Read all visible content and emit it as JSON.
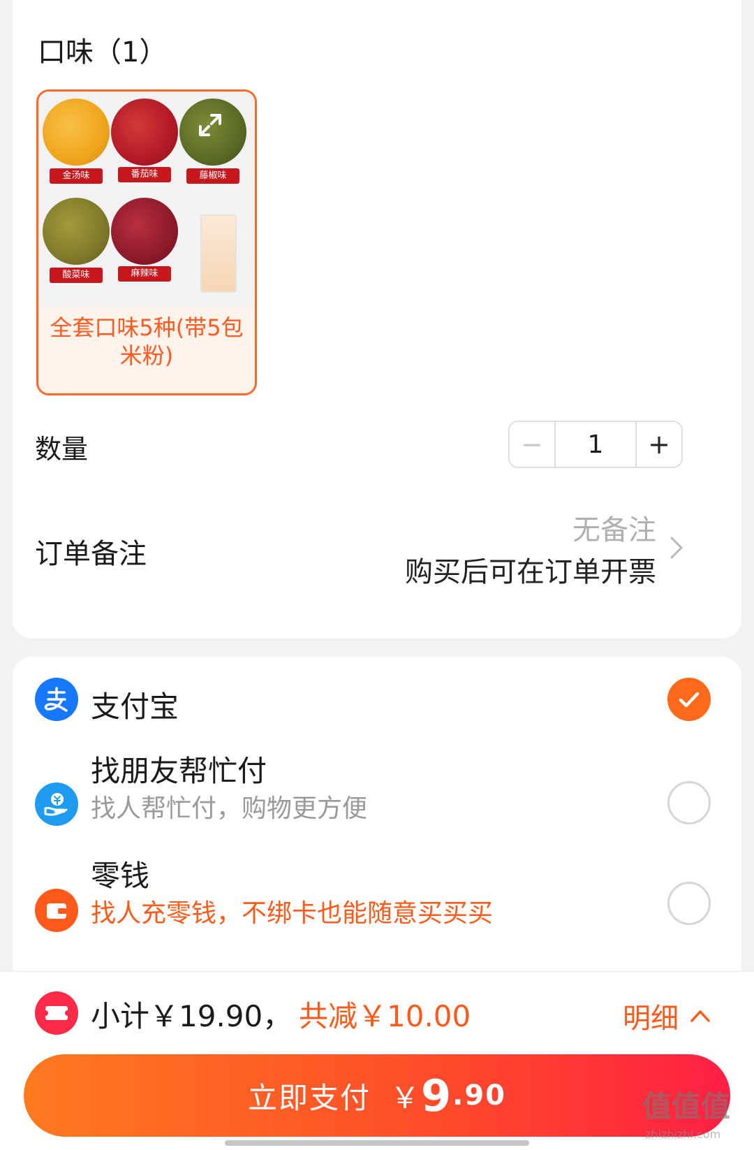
{
  "flavor": {
    "title": "口味（1）",
    "option_label": "全套口味5种(带5包米粉)",
    "bowls": [
      {
        "tag": "金汤味",
        "color": "#f0a51c"
      },
      {
        "tag": "番茄味",
        "color": "#b21a26"
      },
      {
        "tag": "藤椒味",
        "color": "#5a6b24"
      },
      {
        "tag": "酸菜味",
        "color": "#7f7a2a"
      },
      {
        "tag": "麻辣味",
        "color": "#8e1a2a"
      }
    ]
  },
  "quantity": {
    "label": "数量",
    "minus": "−",
    "value": "1",
    "plus": "+"
  },
  "note": {
    "label": "订单备注",
    "value": "无备注",
    "sub": "购买后可在订单开票"
  },
  "payment": {
    "methods": [
      {
        "title": "支付宝",
        "subtitle": "",
        "icon": "alipay-icon",
        "selected": true
      },
      {
        "title": "找朋友帮忙付",
        "subtitle": "找人帮忙付，购物更方便",
        "icon": "friend-pay-icon",
        "selected": false
      },
      {
        "title": "零钱",
        "subtitle": "找人充零钱，不绑卡也能随意买买买",
        "icon": "wallet-icon",
        "selected": false
      }
    ]
  },
  "summary": {
    "subtotal": "小计￥19.90，",
    "discount": "共减￥10.00",
    "detail": "明细"
  },
  "pay_button": {
    "label": "立即支付",
    "currency": "￥",
    "amount_int": "9",
    "amount_dec": ".90"
  },
  "watermark": {
    "text": "值值值",
    "sub": "zhizhizhi.com"
  },
  "colors": {
    "accent": "#ff6a1a",
    "alipay": "#1677ff",
    "friend": "#1f9bf0",
    "wallet": "#ff5a1a"
  }
}
